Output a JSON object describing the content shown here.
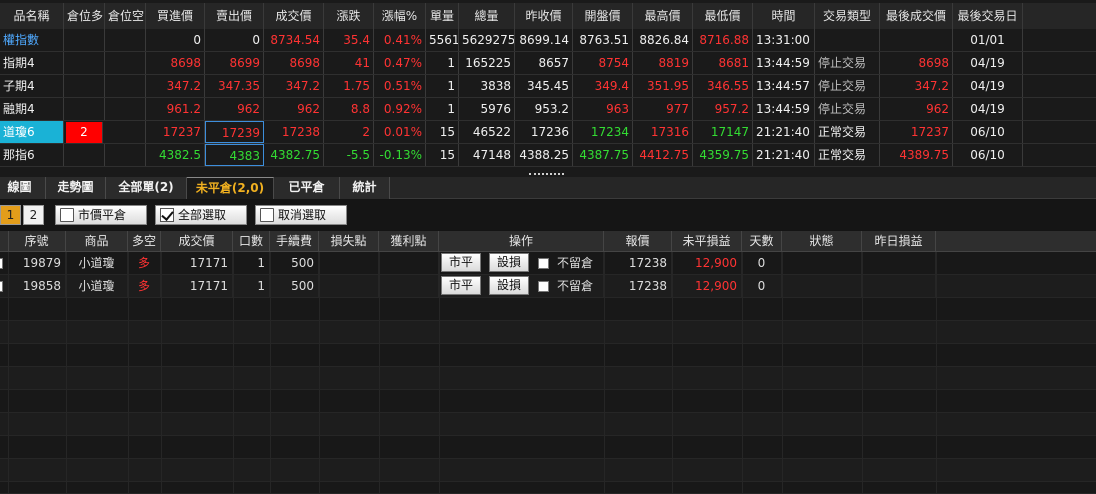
{
  "quote": {
    "headers": [
      "品名稱",
      "倉位多",
      "倉位空",
      "買進價",
      "賣出價",
      "成交價",
      "漲跌",
      "漲幅%",
      "單量",
      "總量",
      "昨收價",
      "開盤價",
      "最高價",
      "最低價",
      "時間",
      "交易類型",
      "最後成交價",
      "最後交易日"
    ],
    "rows": [
      {
        "name": "權指數",
        "pos_long": "",
        "pos_short": "",
        "bid": "0",
        "ask": "0",
        "last": "8734.54",
        "change": "35.4",
        "pct": "0.41%",
        "vol": "5561",
        "total": "5629275",
        "prev": "8699.14",
        "open": "8763.51",
        "high": "8826.84",
        "low": "8716.88",
        "time": "13:31:00",
        "trade_type": "",
        "last_trade": "",
        "last_date": "01/01"
      },
      {
        "name": "指期4",
        "pos_long": "",
        "pos_short": "",
        "bid": "8698",
        "ask": "8699",
        "last": "8698",
        "change": "41",
        "pct": "0.47%",
        "vol": "1",
        "total": "165225",
        "prev": "8657",
        "open": "8754",
        "high": "8819",
        "low": "8681",
        "time": "13:44:59",
        "trade_type": "停止交易",
        "last_trade": "8698",
        "last_date": "04/19"
      },
      {
        "name": "子期4",
        "pos_long": "",
        "pos_short": "",
        "bid": "347.2",
        "ask": "347.35",
        "last": "347.2",
        "change": "1.75",
        "pct": "0.51%",
        "vol": "1",
        "total": "3838",
        "prev": "345.45",
        "open": "349.4",
        "high": "351.95",
        "low": "346.55",
        "time": "13:44:57",
        "trade_type": "停止交易",
        "last_trade": "347.2",
        "last_date": "04/19"
      },
      {
        "name": "融期4",
        "pos_long": "",
        "pos_short": "",
        "bid": "961.2",
        "ask": "962",
        "last": "962",
        "change": "8.8",
        "pct": "0.92%",
        "vol": "1",
        "total": "5976",
        "prev": "953.2",
        "open": "963",
        "high": "977",
        "low": "957.2",
        "time": "13:44:59",
        "trade_type": "停止交易",
        "last_trade": "962",
        "last_date": "04/19"
      },
      {
        "name": "道瓊6",
        "pos_long": "",
        "pos_short": "2",
        "bid": "17237",
        "ask": "17239",
        "last": "17238",
        "change": "2",
        "pct": "0.01%",
        "vol": "15",
        "total": "46522",
        "prev": "17236",
        "open": "17234",
        "high": "17316",
        "low": "17147",
        "time": "21:21:40",
        "trade_type": "正常交易",
        "last_trade": "17237",
        "last_date": "06/10"
      },
      {
        "name": "那指6",
        "pos_long": "",
        "pos_short": "",
        "bid": "4382.5",
        "ask": "4383",
        "last": "4382.75",
        "change": "-5.5",
        "pct": "-0.13%",
        "vol": "15",
        "total": "47148",
        "prev": "4388.25",
        "open": "4387.75",
        "high": "4412.75",
        "low": "4359.75",
        "time": "21:21:40",
        "trade_type": "正常交易",
        "last_trade": "4389.75",
        "last_date": "06/10"
      }
    ]
  },
  "tabs": [
    "線圖",
    "走勢圖",
    "全部單(2)",
    "未平倉(2,0)",
    "已平倉",
    "統計"
  ],
  "toolbar": {
    "page1": "1",
    "page2": "2",
    "market_close": "市價平倉",
    "select_all": "全部選取",
    "deselect": "取消選取"
  },
  "positions": {
    "headers": [
      "序號",
      "商品",
      "多空",
      "成交價",
      "口數",
      "手續費",
      "損失點",
      "獲利點",
      "操作",
      "報價",
      "未平損益",
      "天數",
      "狀態",
      "昨日損益"
    ],
    "rows": [
      {
        "seq": "19879",
        "product": "小道瓊",
        "side": "多",
        "price": "17171",
        "qty": "1",
        "fee": "500",
        "loss": "",
        "profit": "",
        "btn1": "市平",
        "btn2": "設損",
        "keep": "不留倉",
        "quote": "17238",
        "pnl": "12,900",
        "days": "0",
        "status": "",
        "yday": ""
      },
      {
        "seq": "19858",
        "product": "小道瓊",
        "side": "多",
        "price": "17171",
        "qty": "1",
        "fee": "500",
        "loss": "",
        "profit": "",
        "btn1": "市平",
        "btn2": "設損",
        "keep": "不留倉",
        "quote": "17238",
        "pnl": "12,900",
        "days": "0",
        "status": "",
        "yday": ""
      }
    ]
  },
  "colors": {
    "up": "#ff3333",
    "down": "#33dd33",
    "accent_tab": "#f0b020",
    "badge_cyan": "#1ab2d6",
    "badge_red": "#ff0000"
  }
}
